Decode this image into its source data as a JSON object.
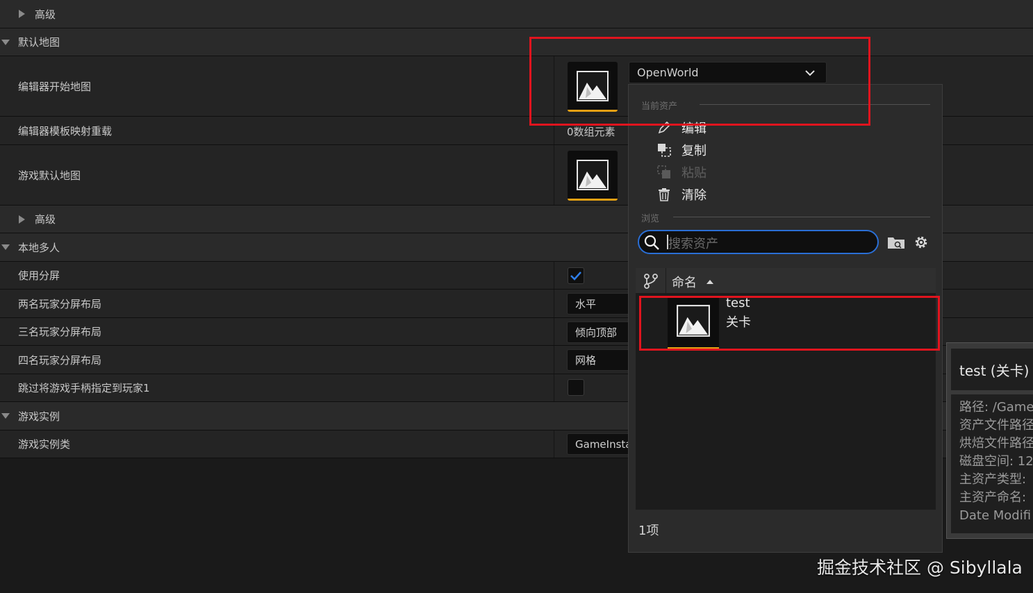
{
  "rows": {
    "advanced_top": "高级",
    "default_maps": "默认地图",
    "editor_startup_map": "编辑器开始地图",
    "editor_template_map_overrides": "编辑器模板映射重载",
    "template_array_value": "0数组元素",
    "game_default_map": "游戏默认地图",
    "advanced_mid": "高级",
    "local_multiplayer": "本地多人",
    "use_splitscreen": "使用分屏",
    "two_player_layout": "两名玩家分屏布局",
    "two_player_value": "水平",
    "three_player_layout": "三名玩家分屏布局",
    "three_player_value": "倾向顶部",
    "four_player_layout": "四名玩家分屏布局",
    "four_player_value": "网格",
    "skip_gamepad": "跳过将游戏手柄指定到玩家1",
    "game_instance": "游戏实例",
    "game_instance_class": "游戏实例类",
    "game_instance_value": "GameInsta"
  },
  "asset_combo": {
    "value": "OpenWorld"
  },
  "popup": {
    "current_asset_header": "当前资产",
    "edit": "编辑",
    "copy": "复制",
    "paste": "粘贴",
    "clear": "清除",
    "browse_header": "浏览",
    "search_placeholder": "搜索资产",
    "column_name": "命名",
    "asset_name": "test",
    "asset_type": "关卡",
    "item_count": "1项"
  },
  "tooltip": {
    "title": "test (关卡)",
    "lines": [
      "路径: /Game",
      "资产文件路径",
      "烘焙文件路径",
      "磁盘空间: 12",
      "主资产类型:",
      "主资产命名:",
      "Date Modifi"
    ]
  },
  "watermark": "掘金技术社区 @ Sibyllala",
  "colors": {
    "accent_orange": "#e4a013",
    "highlight_red": "#e0141e",
    "checkbox_blue": "#2f7ee8",
    "search_focus": "#2a6fd6"
  }
}
